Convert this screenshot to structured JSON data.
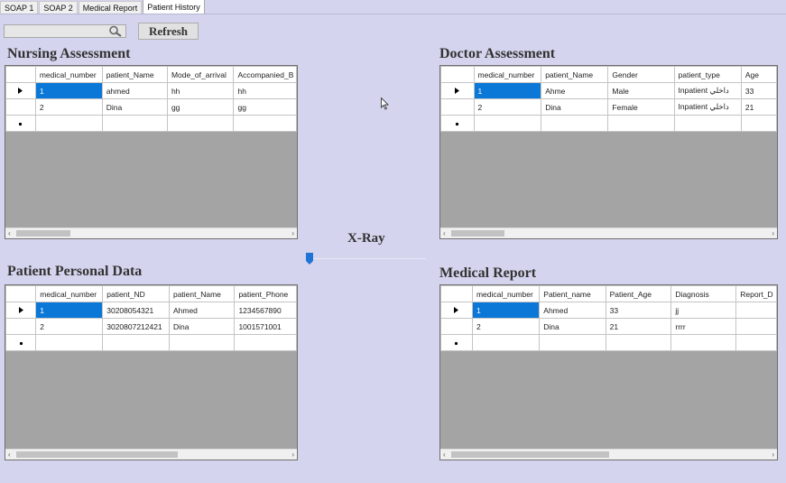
{
  "tabs": [
    "SOAP 1",
    "SOAP 2",
    "Medical Report",
    "Patient History"
  ],
  "active_tab": "Patient History",
  "search": {
    "value": "",
    "placeholder": ""
  },
  "refresh_label": "Refresh",
  "xray_label": "X-Ray",
  "slider": {
    "value": 0
  },
  "grids": {
    "nursing": {
      "title": "Nursing Assessment",
      "columns": [
        "medical_number",
        "patient_Name",
        "Mode_of_arrival",
        "Accompanied_B"
      ],
      "rows": [
        [
          "1",
          "ahmed",
          "hh",
          "hh"
        ],
        [
          "2",
          "Dina",
          "gg",
          "gg"
        ]
      ],
      "scroll_thumb": 0.2
    },
    "doctor": {
      "title": "Doctor Assessment",
      "columns": [
        "medical_number",
        "patient_Name",
        "Gender",
        "patient_type",
        "Age"
      ],
      "rows": [
        [
          "1",
          "Ahme",
          "Male",
          "Inpatient داخلي",
          "33"
        ],
        [
          "2",
          "Dina",
          "Female",
          "Inpatient داخلي",
          "21"
        ]
      ],
      "scroll_thumb": 0.17
    },
    "personal": {
      "title": "Patient Personal Data",
      "columns": [
        "medical_number",
        "patient_ND",
        "patient_Name",
        "patient_Phone"
      ],
      "rows": [
        [
          "1",
          "30208054321",
          "Ahmed",
          "1234567890"
        ],
        [
          "2",
          "3020807212421",
          "Dina",
          "1001571001"
        ]
      ],
      "scroll_thumb": 0.6
    },
    "report": {
      "title": "Medical Report",
      "columns": [
        "medical_number",
        "Patient_name",
        "Patient_Age",
        "Diagnosis",
        "Report_D"
      ],
      "rows": [
        [
          "1",
          "Ahmed",
          "33",
          "jj",
          ""
        ],
        [
          "2",
          "Dina",
          "21",
          "rrrr",
          ""
        ]
      ],
      "scroll_thumb": 0.5
    }
  }
}
